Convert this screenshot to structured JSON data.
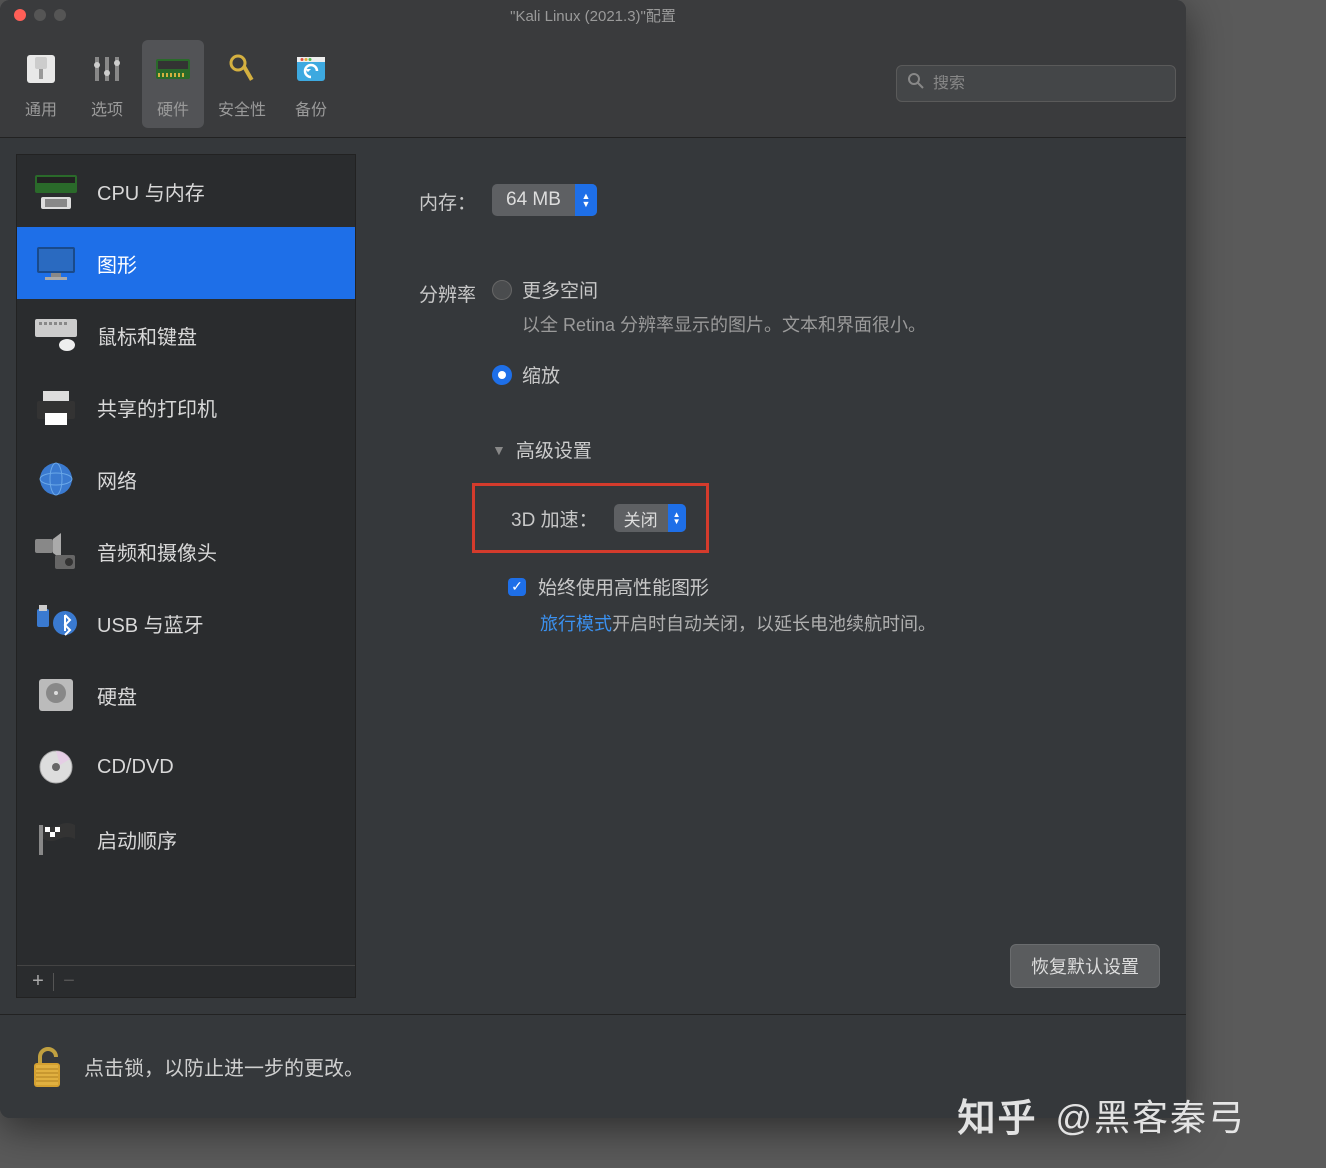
{
  "window": {
    "title": "\"Kali Linux (2021.3)\"配置"
  },
  "toolbar": {
    "items": [
      {
        "label": "通用",
        "icon": "switch"
      },
      {
        "label": "选项",
        "icon": "sliders"
      },
      {
        "label": "硬件",
        "icon": "chip",
        "active": true
      },
      {
        "label": "安全性",
        "icon": "key"
      },
      {
        "label": "备份",
        "icon": "refresh"
      }
    ],
    "search_placeholder": "搜索"
  },
  "sidebar": {
    "items": [
      {
        "label": "CPU 与内存",
        "icon": "cpu"
      },
      {
        "label": "图形",
        "icon": "display",
        "selected": true
      },
      {
        "label": "鼠标和键盘",
        "icon": "mouse"
      },
      {
        "label": "共享的打印机",
        "icon": "printer"
      },
      {
        "label": "网络",
        "icon": "globe"
      },
      {
        "label": "音频和摄像头",
        "icon": "audio"
      },
      {
        "label": "USB 与蓝牙",
        "icon": "usb"
      },
      {
        "label": "硬盘",
        "icon": "hdd"
      },
      {
        "label": "CD/DVD",
        "icon": "disc"
      },
      {
        "label": "启动顺序",
        "icon": "flag"
      }
    ]
  },
  "panel": {
    "memory": {
      "label": "内存：",
      "value": "64 MB"
    },
    "resolution": {
      "label": "分辨率",
      "opt_more": "更多空间",
      "opt_more_hint": "以全 Retina 分辨率显示的图片。文本和界面很小。",
      "opt_scaled": "缩放"
    },
    "advanced": {
      "title": "高级设置",
      "accel_label": "3D 加速：",
      "accel_value": "关闭",
      "perf_checkbox": "始终使用高性能图形",
      "perf_note_pre": "旅行模式",
      "perf_note_post": "开启时自动关闭，以延长电池续航时间。"
    },
    "restore": "恢复默认设置"
  },
  "footer": {
    "lock_text": "点击锁，以防止进一步的更改。"
  },
  "watermark": {
    "zhihu": "知乎",
    "author": "@黑客秦弓"
  }
}
